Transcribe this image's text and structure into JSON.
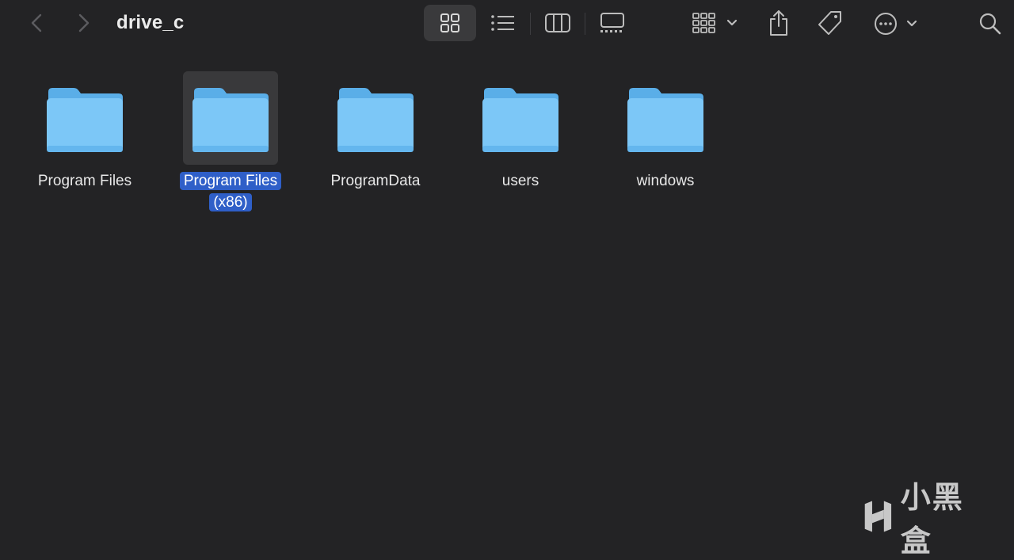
{
  "window": {
    "title": "drive_c"
  },
  "toolbar": {
    "back_icon": "chevron-left-icon",
    "forward_icon": "chevron-right-icon",
    "views": [
      {
        "icon": "icon-view-icon",
        "active": true
      },
      {
        "icon": "list-view-icon",
        "active": false
      },
      {
        "icon": "column-view-icon",
        "active": false
      },
      {
        "icon": "gallery-view-icon",
        "active": false
      }
    ],
    "actions": [
      "group-by-icon",
      "share-icon",
      "tag-icon",
      "more-icon",
      "search-icon"
    ]
  },
  "items": [
    {
      "name": "Program Files",
      "selected": false
    },
    {
      "name": "Program Files (x86)",
      "selected": true
    },
    {
      "name": "ProgramData",
      "selected": false
    },
    {
      "name": "users",
      "selected": false
    },
    {
      "name": "windows",
      "selected": false
    }
  ],
  "watermark": {
    "text": "小黑盒"
  },
  "colors": {
    "background": "#232325",
    "folder_light": "#7cc7f7",
    "folder_dark": "#5aaee8",
    "selection": "#2f5fc8"
  }
}
